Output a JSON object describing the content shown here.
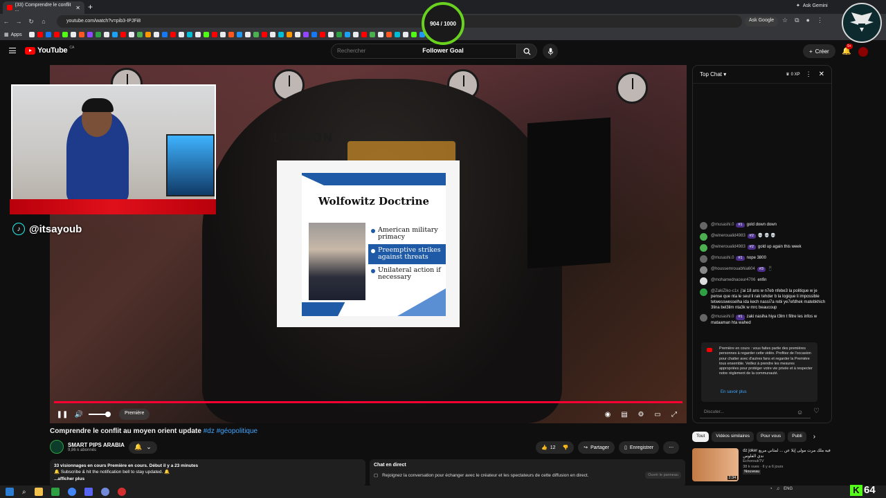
{
  "browser": {
    "tab_title": "(33) Comprendre le conflit ...",
    "url": "youtube.com/watch?v=pib3-IPJFi8",
    "ask_gemini": "Ask Gemini",
    "ask_google": "Ask Google",
    "apps_label": "Apps"
  },
  "overlay": {
    "follower_count": "904 / 1000",
    "follower_goal_label": "Follower Goal",
    "tiktok_handle": "@itsayoub",
    "kick_count": "64"
  },
  "youtube": {
    "logo": "YouTube",
    "region": "CA",
    "search_placeholder": "Rechercher",
    "create_label": "Créer",
    "notif_badge": "9+"
  },
  "video": {
    "london_sign": "LONDON",
    "doc_title": "Wolfowitz Doctrine",
    "bullets": [
      "American military primacy",
      "Preemptive strikes against threats",
      "Unilateral action if necessary"
    ],
    "premiere_label": "Première",
    "progress": 1.0,
    "title": "Comprendre le conflit au moyen orient update",
    "tags": "#dz #géopolitique",
    "channel_name": "SMART PIPS ARABIA",
    "channel_subs": "9,86 k abonnés",
    "likes": "12",
    "share_label": "Partager",
    "save_label": "Enregistrer",
    "description_line1": "33 visionnages en cours  Première en cours. Début il y a 23 minutes",
    "description_line2": "🔔 Subscribe & hit the notification bell to stay updated. 🔔",
    "show_more": "...afficher plus"
  },
  "chat": {
    "mode": "Top Chat",
    "xp": "0 XP",
    "messages": [
      {
        "user": "@musashi.0",
        "rank": "#1",
        "text": "gold down down"
      },
      {
        "user": "@wineroualid4983",
        "rank": "#2",
        "text": "💀 💀 💀"
      },
      {
        "user": "@wineroualid4983",
        "rank": "#2",
        "text": "gold up again this week"
      },
      {
        "user": "@musashi.0",
        "rank": "#1",
        "text": "nope 3800"
      },
      {
        "user": "@houssemrouabhia604",
        "rank": "#3",
        "text": "📱"
      },
      {
        "user": "@mohamednaceur4706",
        "rank": "",
        "text": "enfin"
      },
      {
        "user": "@ZakiZiko-c1x",
        "rank": "",
        "text": "j'ai 18 ans w n7eb nfebe3 la politique w je pense que nta le seul li rak tehder b la logique li impossible tetwesswesselha ida kech nassi7a rebi ye7efdhek matebkhich 3lina bel3ilm nta3k w mrc beaucoup"
      },
      {
        "user": "@musashi.0",
        "rank": "#1",
        "text": "zaki nasiha hiya t3lm t filtre les infos w mataaman hta wahed"
      }
    ],
    "notice": "Première en cours : vous faites partie des premières personnes à regarder cette vidéo. Profitez de l'occasion pour chatter avec d'autres fans et regarder la Première tous ensemble. Veillez à prendre les mesures appropriées pour protéger votre vie privée et à respecter notre règlement de la communauté.",
    "learn_more": "En savoir plus",
    "input_placeholder": "Discuter..."
  },
  "live_chat_box": {
    "title": "Chat en direct",
    "text": "Rejoignez la conversation pour échanger avec le créateur et les spectateurs de cette diffusion en direct.",
    "button": "Ouvrir le panneau"
  },
  "recommendations": {
    "chips": [
      "Tout",
      "Vidéos similaires",
      "Pour vous",
      "Publi"
    ],
    "item": {
      "title": "dz joker فيه ملك مرت مولى إيلا عن ... لمثاني مريع ندي الفلوس",
      "channel": "EchoroukTV",
      "views": "38 k vues · Il y a 6 jours",
      "duration": "2:34",
      "badge": "Nouveau"
    }
  },
  "taskbar": {
    "lang": "ENG"
  }
}
